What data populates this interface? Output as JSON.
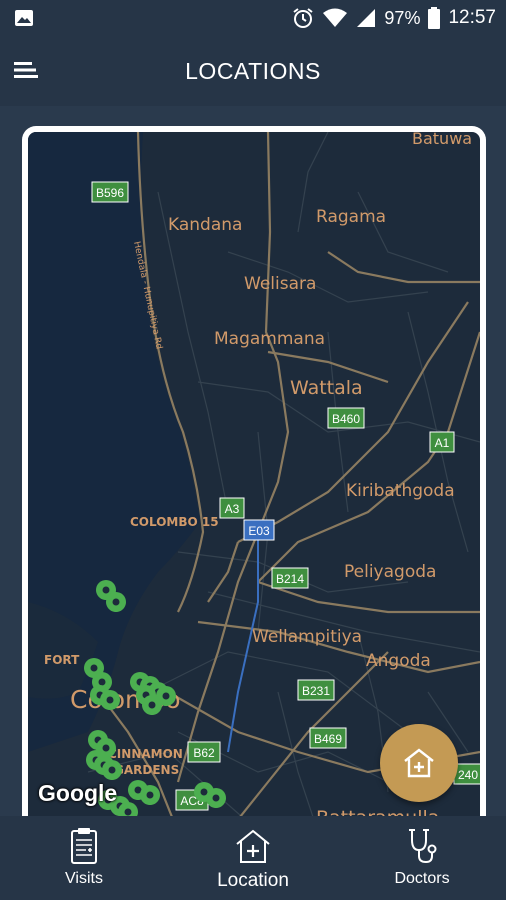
{
  "status_bar": {
    "battery": "97%",
    "time": "12:57",
    "icons": [
      "image-icon",
      "alarm-icon",
      "wifi-icon",
      "signal-icon",
      "battery-icon"
    ]
  },
  "app_bar": {
    "title": "LOCATIONS",
    "menu_icon": "menu-icon"
  },
  "map": {
    "places": [
      {
        "id": "batuwa",
        "label": "Batuwa"
      },
      {
        "id": "kandana",
        "label": "Kandana"
      },
      {
        "id": "ragama",
        "label": "Ragama"
      },
      {
        "id": "welisara",
        "label": "Welisara"
      },
      {
        "id": "magammana",
        "label": "Magammana"
      },
      {
        "id": "wattala",
        "label": "Wattala"
      },
      {
        "id": "kiribathgoda",
        "label": "Kiribathgoda"
      },
      {
        "id": "colombo15",
        "label": "COLOMBO 15"
      },
      {
        "id": "peliyagoda",
        "label": "Peliyagoda"
      },
      {
        "id": "wellampitiya",
        "label": "Wellampitiya"
      },
      {
        "id": "angoda",
        "label": "Angoda"
      },
      {
        "id": "fort",
        "label": "FORT"
      },
      {
        "id": "colombo",
        "label": "Colombo"
      },
      {
        "id": "cinnamon1",
        "label": "CINNAMON"
      },
      {
        "id": "cinnamon2",
        "label": "GARDENS"
      },
      {
        "id": "battaramulla",
        "label": "Battaramulla"
      },
      {
        "id": "road",
        "label": "Hendala - Hunupitiya Rd"
      }
    ],
    "road_shields": [
      {
        "id": "b596",
        "label": "B596"
      },
      {
        "id": "b460",
        "label": "B460"
      },
      {
        "id": "a1",
        "label": "A1"
      },
      {
        "id": "a3",
        "label": "A3"
      },
      {
        "id": "e03",
        "label": "E03"
      },
      {
        "id": "b214",
        "label": "B214"
      },
      {
        "id": "b231",
        "label": "B231"
      },
      {
        "id": "b469",
        "label": "B469"
      },
      {
        "id": "b62",
        "label": "B62"
      },
      {
        "id": "ac8",
        "label": "AC8"
      },
      {
        "id": "n240",
        "label": "240"
      }
    ],
    "attribution": "Google",
    "marker_color": "#4caf50"
  },
  "fab": {
    "icon": "add-hospital-icon"
  },
  "bottom_nav": {
    "items": [
      {
        "label": "Visits",
        "icon": "clipboard-icon"
      },
      {
        "label": "Location",
        "icon": "hospital-icon",
        "active": true
      },
      {
        "label": "Doctors",
        "icon": "stethoscope-icon"
      }
    ]
  },
  "colors": {
    "app_bg": "#263547",
    "map_bg": "#1d2b3b",
    "water": "#16283f",
    "label": "#d19a6a",
    "road": "#8a7a5f",
    "shield_green": "#3f8f3f",
    "shield_blue": "#3a6fc0",
    "accent": "#c49a54"
  }
}
